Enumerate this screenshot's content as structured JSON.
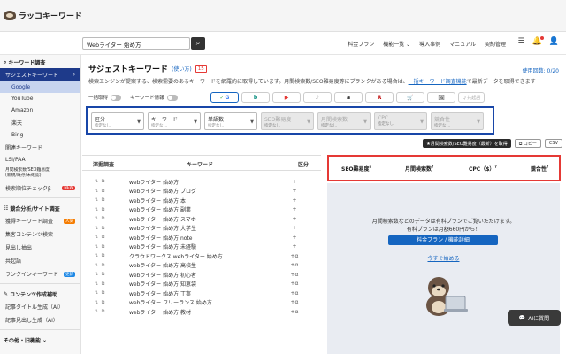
{
  "app": {
    "logo_text": "ラッコキーワード"
  },
  "search": {
    "value": "Webライター 始め方",
    "button_icon": "search-icon"
  },
  "topnav": {
    "items": [
      "料金プラン",
      "機能一覧 ⌄",
      "導入事例",
      "マニュアル",
      "契約管理"
    ]
  },
  "sidebar": {
    "sections": [
      {
        "title": "キーワード調査",
        "items": [
          {
            "label": "サジェストキーワード",
            "active": true
          },
          {
            "label": "Google",
            "sub": true,
            "selected": true
          },
          {
            "label": "YouTube",
            "sub": true
          },
          {
            "label": "Amazon",
            "sub": true
          },
          {
            "label": "楽天",
            "sub": true
          },
          {
            "label": "Bing",
            "sub": true
          },
          {
            "label": "関連キーワード"
          },
          {
            "label": "LSI/PAA"
          },
          {
            "label": "月間検索数/SEO難易度\n(新規/既存/未確認)"
          },
          {
            "label": "検索順位チェックβ",
            "badge": "NEW"
          }
        ]
      },
      {
        "title": "競合分析/サイト調査",
        "items": [
          {
            "label": "獲得キーワード調査",
            "badge": "人気"
          },
          {
            "label": "集客コンテンツ検索"
          },
          {
            "label": "見出し抽出"
          },
          {
            "label": "共起語"
          },
          {
            "label": "ランクインキーワード",
            "badge": "更新"
          }
        ]
      },
      {
        "title": "コンテンツ作成補助",
        "items": [
          {
            "label": "記事タイトル生成（AI）"
          },
          {
            "label": "記事見出し生成（AI）"
          }
        ]
      },
      {
        "title": "その他・旧機能",
        "items": []
      }
    ]
  },
  "main": {
    "title": "サジェストキーワード",
    "howto": "(使い方)",
    "count": "15",
    "usage": "使用回数: 0/20",
    "desc_prefix": "検索エンジンが提案する、検索需要のあるキーワードを網羅的に取得しています。月間検索数/SEO難易度等にブランクがある場合は、",
    "desc_link": "一括キーワード調査機能",
    "desc_suffix": "で最新データを取得できます",
    "toggle_bulk": "一括取得",
    "toggle_kw_info": "キーワード情報",
    "engines": [
      "G",
      "b",
      "▶",
      "♪",
      "a",
      "R",
      "🛒",
      "🖼",
      "Q 共起語"
    ],
    "filters": [
      {
        "label": "区分",
        "value": "指定なし",
        "disabled": false
      },
      {
        "label": "キーワード",
        "value": "指定なし",
        "disabled": false
      },
      {
        "label": "単語数",
        "value": "指定なし",
        "disabled": false
      },
      {
        "label": "SEO難易度",
        "value": "指定なし",
        "disabled": true
      },
      {
        "label": "月間検索数",
        "value": "指定なし",
        "disabled": true
      },
      {
        "label": "CPC",
        "value": "指定なし",
        "disabled": true
      },
      {
        "label": "競合性",
        "value": "指定なし",
        "disabled": true
      }
    ],
    "actions": {
      "fetch": "★月間検索数/SEO難易度（最新）を取得",
      "copy": "⧉ コピー",
      "csv": "CSV"
    },
    "table": {
      "col_deep": "深掘調査",
      "col_keyword": "キーワード",
      "col_type": "区分",
      "rows": [
        {
          "keyword": "webライター 始め方",
          "type": "+"
        },
        {
          "keyword": "webライター 始め方 ブログ",
          "type": "+"
        },
        {
          "keyword": "webライター 始め方 本",
          "type": "+"
        },
        {
          "keyword": "webライター 始め方 副業",
          "type": "+"
        },
        {
          "keyword": "webライター 始め方 スマホ",
          "type": "+"
        },
        {
          "keyword": "webライター 始め方 大学生",
          "type": "+"
        },
        {
          "keyword": "webライター 始め方 note",
          "type": "+"
        },
        {
          "keyword": "webライター 始め方 未経験",
          "type": "+"
        },
        {
          "keyword": "クラウドワークス webライター 始め方",
          "type": "+α"
        },
        {
          "keyword": "webライター 始め方 高校生",
          "type": "+α"
        },
        {
          "keyword": "webライター 始め方 初心者",
          "type": "+α"
        },
        {
          "keyword": "webライター 始め方 知恵袋",
          "type": "+α"
        },
        {
          "keyword": "webライター 始め方 丁寧",
          "type": "+α"
        },
        {
          "keyword": "webライター フリーランス 始め方",
          "type": "+α"
        },
        {
          "keyword": "webライター 始め方 教材",
          "type": "+α"
        }
      ]
    },
    "metrics": [
      "SEO難易度",
      "月間検索数",
      "CPC（$）",
      "競合性"
    ],
    "locked": {
      "line1": "月間検索数などのデータは有料プランでご覧いただけます。",
      "line2": "有料プランは月額660円から！",
      "plan_button": "料金プラン / 機能詳細",
      "start_link": "今すぐ始める"
    },
    "ai_button": "AIに質問"
  }
}
